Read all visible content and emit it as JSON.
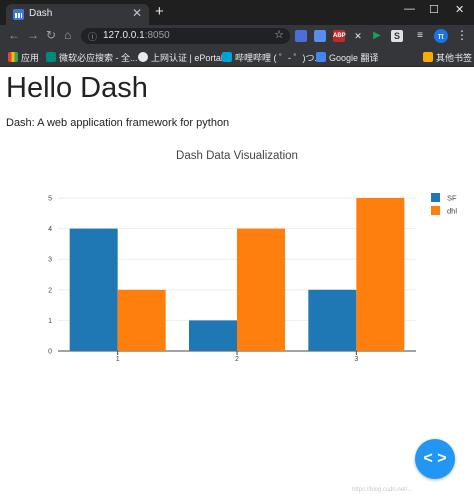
{
  "browser": {
    "tab_title": "Dash",
    "tab_close": "✕",
    "new_tab": "+",
    "url_host": "127.0.0.1",
    "url_port": ":8050",
    "bookmarks": [
      "应用",
      "微软必应搜索 - 全...",
      "上网认证 | ePortal",
      "哔哩哔哩 ( ゜- ゜)つ...",
      "Google 翻译",
      "其他书签"
    ],
    "profile_initial": "π"
  },
  "page": {
    "title": "Hello Dash",
    "subtitle": "Dash: A web application framework for python"
  },
  "chart_data": {
    "type": "bar",
    "title": "Dash Data Visualization",
    "categories": [
      "1",
      "2",
      "3"
    ],
    "series": [
      {
        "name": "SF",
        "values": [
          4,
          1,
          2
        ],
        "color": "#1f77b4"
      },
      {
        "name": "dhl",
        "values": [
          2,
          4,
          5
        ],
        "color": "#ff7f0e"
      }
    ],
    "y_ticks": [
      "0",
      "1",
      "2",
      "3",
      "4",
      "5"
    ],
    "ylim": [
      0,
      5
    ],
    "grid": true,
    "legend": "top-right"
  },
  "fab_icon": "< >"
}
